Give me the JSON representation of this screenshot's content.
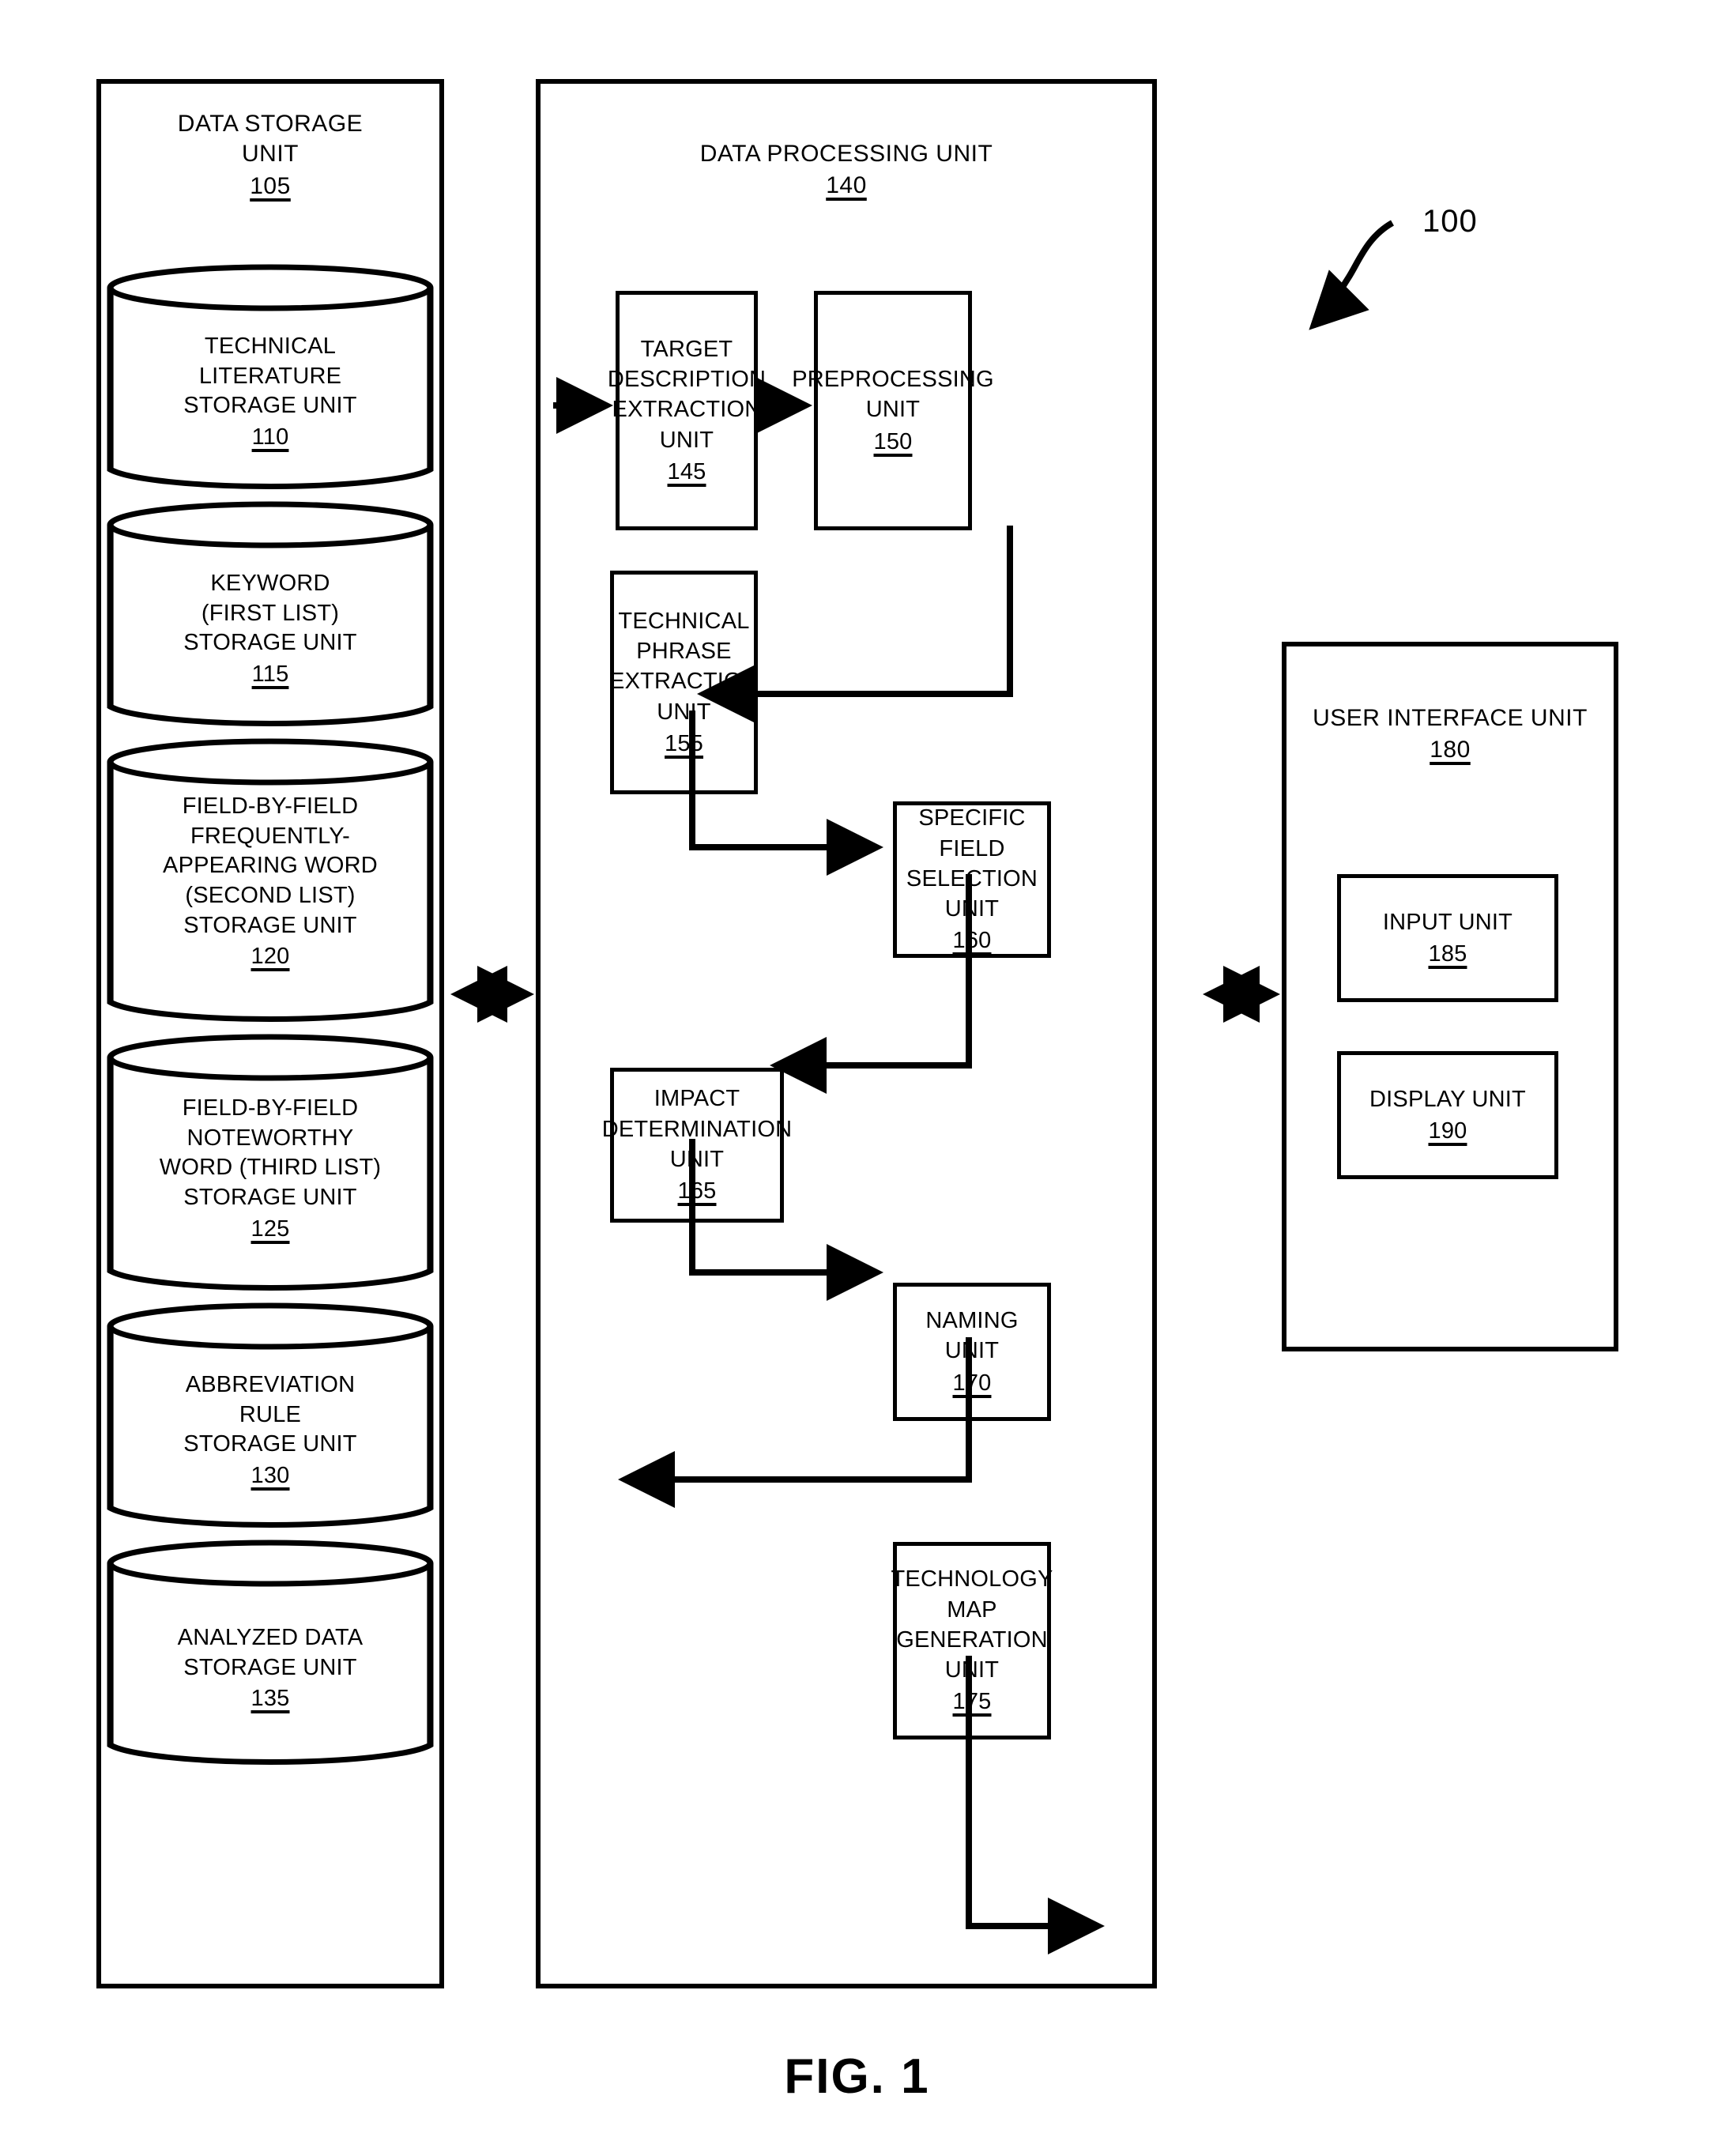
{
  "figure": {
    "caption": "FIG. 1",
    "system_callout": "100"
  },
  "data_storage_unit": {
    "title_line1": "DATA STORAGE",
    "title_line2": "UNIT",
    "ref": "105",
    "stores": [
      {
        "lines": [
          "TECHNICAL",
          "LITERATURE",
          "STORAGE UNIT"
        ],
        "ref": "110"
      },
      {
        "lines": [
          "KEYWORD",
          "(FIRST LIST)",
          "STORAGE UNIT"
        ],
        "ref": "115"
      },
      {
        "lines": [
          "FIELD-BY-FIELD",
          "FREQUENTLY-",
          "APPEARING WORD",
          "(SECOND LIST)",
          "STORAGE UNIT"
        ],
        "ref": "120"
      },
      {
        "lines": [
          "FIELD-BY-FIELD",
          "NOTEWORTHY",
          "WORD (THIRD LIST)",
          "STORAGE UNIT"
        ],
        "ref": "125"
      },
      {
        "lines": [
          "ABBREVIATION",
          "RULE",
          "STORAGE UNIT"
        ],
        "ref": "130"
      },
      {
        "lines": [
          "ANALYZED DATA",
          "STORAGE UNIT"
        ],
        "ref": "135"
      }
    ]
  },
  "data_processing_unit": {
    "title_line1": "DATA PROCESSING UNIT",
    "ref": "140",
    "units": [
      {
        "lines": [
          "TARGET",
          "DESCRIPTION",
          "EXTRACTION",
          "UNIT"
        ],
        "ref": "145"
      },
      {
        "lines": [
          "PREPROCESSING",
          "UNIT"
        ],
        "ref": "150"
      },
      {
        "lines": [
          "TECHNICAL",
          "PHRASE",
          "EXTRACTION",
          "UNIT"
        ],
        "ref": "155"
      },
      {
        "lines": [
          "SPECIFIC FIELD",
          "SELECTION",
          "UNIT"
        ],
        "ref": "160"
      },
      {
        "lines": [
          "IMPACT",
          "DETERMINATION",
          "UNIT"
        ],
        "ref": "165"
      },
      {
        "lines": [
          "NAMING",
          "UNIT"
        ],
        "ref": "170"
      },
      {
        "lines": [
          "TECHNOLOGY",
          "MAP",
          "GENERATION",
          "UNIT"
        ],
        "ref": "175"
      }
    ]
  },
  "user_interface_unit": {
    "title_line1": "USER INTERFACE UNIT",
    "ref": "180",
    "subunits": [
      {
        "lines": [
          "INPUT UNIT"
        ],
        "ref": "185"
      },
      {
        "lines": [
          "DISPLAY UNIT"
        ],
        "ref": "190"
      }
    ]
  },
  "colors": {
    "line": "#000000",
    "background": "#ffffff"
  }
}
